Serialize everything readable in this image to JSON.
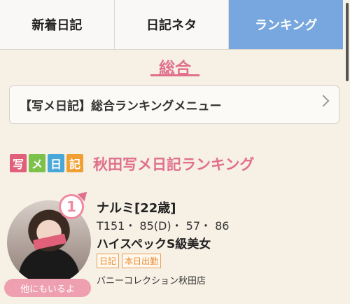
{
  "tabs": [
    {
      "label": "新着日記"
    },
    {
      "label": "日記ネタ"
    },
    {
      "label": "ランキング",
      "active": true
    }
  ],
  "section": {
    "title": "総合"
  },
  "menu": {
    "label": "【写メ日記】総合ランキングメニュー"
  },
  "logo": {
    "chars": [
      "写",
      "メ",
      "日",
      "記"
    ]
  },
  "ranking": {
    "title": "秋田写メ日記ランキング"
  },
  "entry": {
    "rank": "1",
    "name": "ナルミ[22歳]",
    "size": "T151・ 85(D)・ 57・ 86",
    "catch": "ハイスペックS級美女",
    "tags": [
      "日記",
      "本日出勤"
    ],
    "shop": "バニーコレクション秋田店",
    "more_label": "他にもいるよ"
  },
  "colors": {
    "accent": "#e0708c",
    "tab_active": "#77a7de",
    "tag": "#e88a30"
  }
}
